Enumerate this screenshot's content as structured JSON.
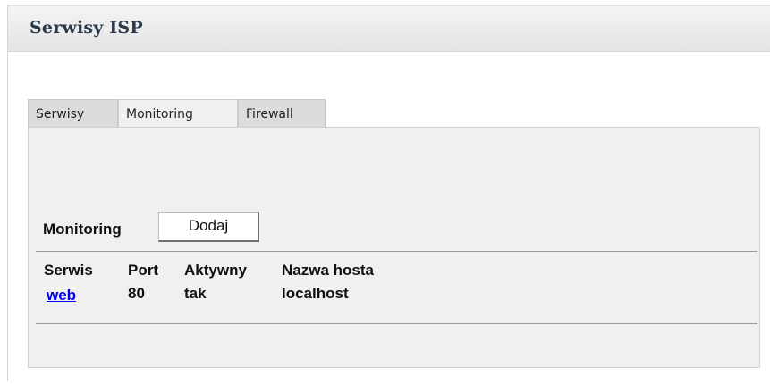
{
  "header": {
    "title": "Serwisy ISP"
  },
  "tabs": [
    {
      "label": "Serwisy",
      "active": false
    },
    {
      "label": "Monitoring",
      "active": true
    },
    {
      "label": "Firewall",
      "active": false
    }
  ],
  "monitoring": {
    "section_label": "Monitoring",
    "add_button_label": "Dodaj",
    "table": {
      "headers": [
        "Serwis",
        "Port",
        "Aktywny",
        "Nazwa hosta"
      ],
      "rows": [
        {
          "serwis": "web",
          "port": "80",
          "aktywny": "tak",
          "nazwa_hosta": "localhost"
        }
      ]
    }
  },
  "colors": {
    "link": "#0000ee",
    "panel_bg": "#f0f0f0",
    "title": "#2b3a4a"
  }
}
